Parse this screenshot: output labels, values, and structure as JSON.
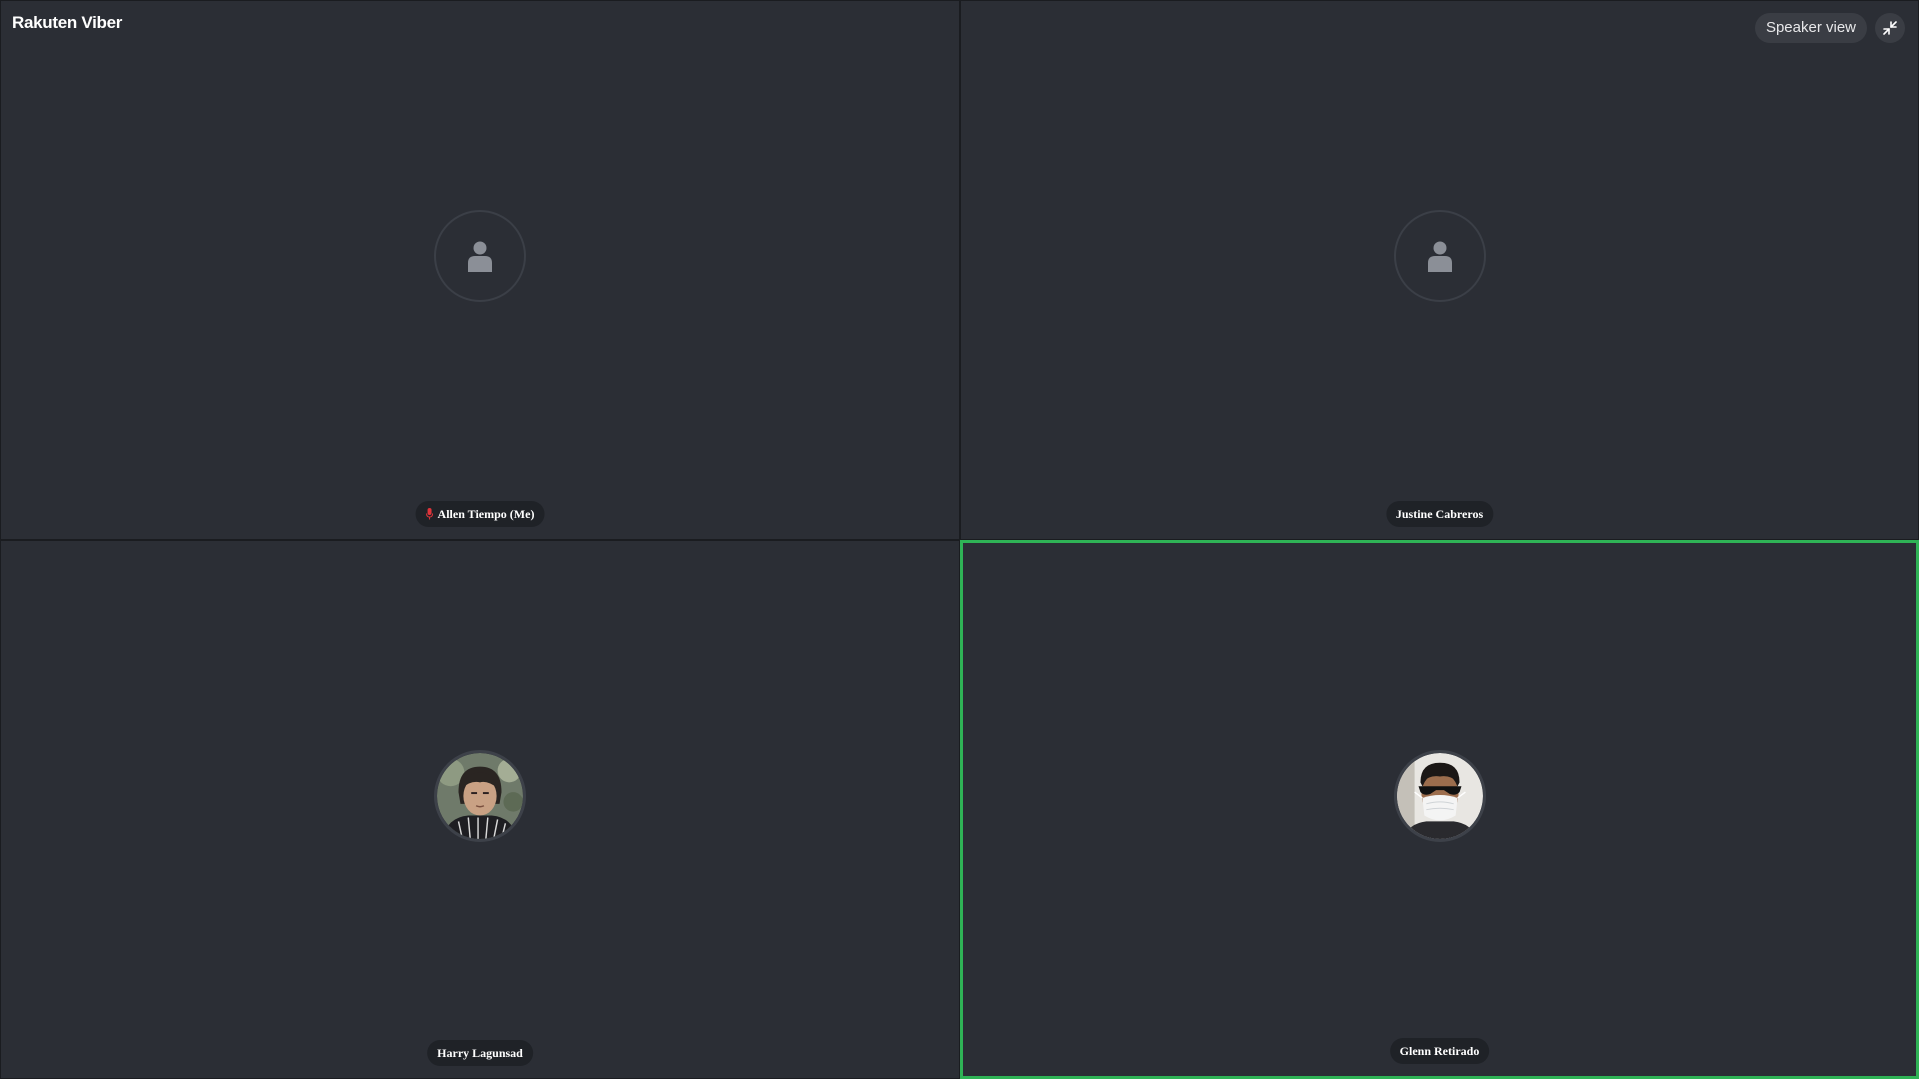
{
  "app": {
    "logo_text": "Rakuten Viber"
  },
  "toolbar": {
    "speaker_view_label": "Speaker view",
    "fullscreen_icon": "collapse-arrows-icon"
  },
  "participants": [
    {
      "name": "Allen Tiempo (Me)",
      "avatar": "default-person-icon",
      "muted": true,
      "speaking": false
    },
    {
      "name": "Justine Cabreros",
      "avatar": "default-person-icon",
      "muted": false,
      "speaking": false
    },
    {
      "name": "Harry Lagunsad",
      "avatar": "profile-photo",
      "muted": false,
      "speaking": false
    },
    {
      "name": "Glenn Retirado",
      "avatar": "profile-photo",
      "muted": false,
      "speaking": true
    }
  ],
  "colors": {
    "tile_background": "#2b2e35",
    "active_speaker_border": "#2fb356",
    "muted_mic": "#e0343a"
  }
}
